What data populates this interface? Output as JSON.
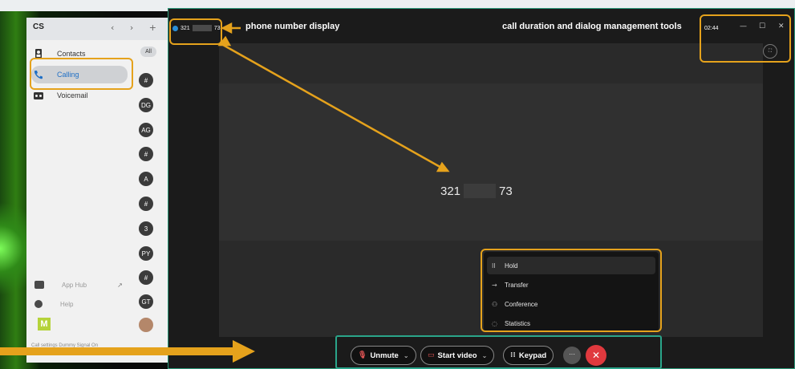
{
  "left_app": {
    "initials": "CS",
    "nav_controls": "‹ › +",
    "nav": [
      {
        "label": "Contacts",
        "icon": "contacts-icon"
      },
      {
        "label": "Calling",
        "icon": "phone-icon"
      },
      {
        "label": "Voicemail",
        "icon": "voicemail-icon"
      }
    ],
    "filter_all": "All",
    "avatars": [
      "#",
      "DG",
      "AG",
      "#",
      "A",
      "#",
      "3",
      "PY",
      "#",
      "GT",
      ""
    ],
    "bottom": [
      {
        "label": "App Hub",
        "icon": "app-hub-icon"
      },
      {
        "label": "Help",
        "icon": "help-icon"
      }
    ],
    "logo_letter": "M",
    "settings_text": "Call settings   Dummy Signal On"
  },
  "call_window": {
    "number_prefix": "321",
    "number_suffix": "73",
    "timer": "02:44",
    "window_controls": [
      "—",
      "☐",
      "✕"
    ],
    "big_number_prefix": "321",
    "big_number_suffix": "73",
    "menu": [
      {
        "label": "Hold",
        "icon": "pause-icon",
        "glyph": "II"
      },
      {
        "label": "Transfer",
        "icon": "arrow-right-icon",
        "glyph": "→"
      },
      {
        "label": "Conference",
        "icon": "conference-icon",
        "glyph": "⚇"
      },
      {
        "label": "Statistics",
        "icon": "statistics-icon",
        "glyph": "◌"
      }
    ],
    "toolbar": {
      "unmute": "Unmute",
      "start_video": "Start video",
      "keypad": "Keypad",
      "more": "···",
      "end": "✕"
    }
  },
  "annotations": {
    "phone_label": "phone number display",
    "tools_label": "call duration and dialog management tools"
  },
  "colors": {
    "annotation_orange": "#e5a21c",
    "annotation_teal": "#2aa58a",
    "end_call_red": "#e0393e"
  }
}
